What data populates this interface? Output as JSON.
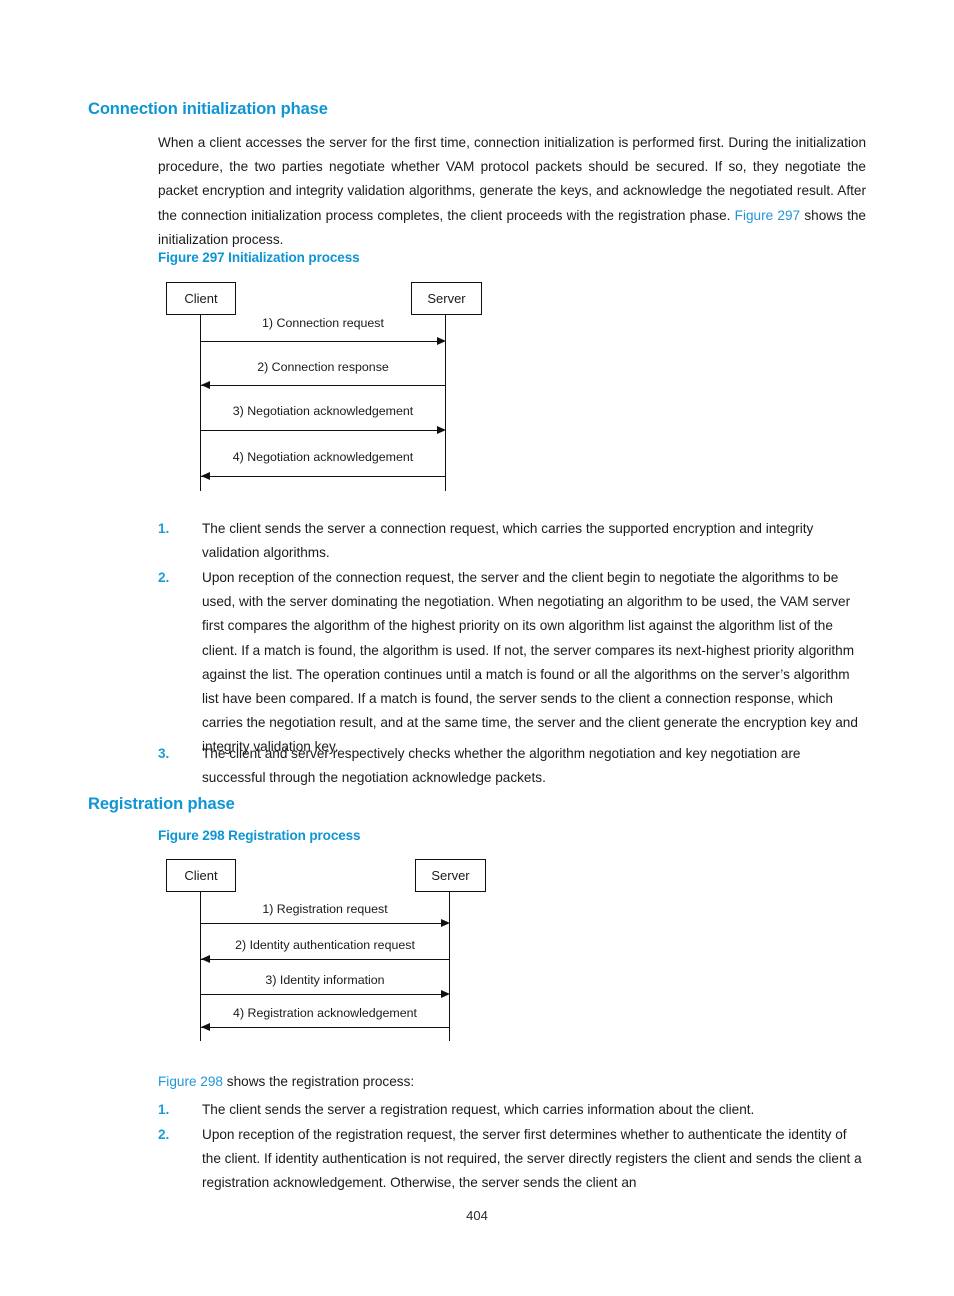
{
  "page": {
    "number": "404"
  },
  "sections": [
    {
      "heading": "Connection initialization phase",
      "intro_a": "When a client accesses the server for the first time, connection initialization is performed first. During the initialization procedure, the two parties negotiate whether VAM protocol packets should be secured. If so, they negotiate the packet encryption and integrity validation algorithms, generate the keys, and acknowledge the negotiated result. After the connection initialization process completes, the client proceeds with the registration phase. ",
      "intro_link": "Figure 297",
      "intro_b": " shows the initialization process.",
      "figure_caption": "Figure 297 Initialization process",
      "steps": [
        {
          "num": "1.",
          "text": "The client sends the server a connection request, which carries the supported encryption and integrity validation algorithms."
        },
        {
          "num": "2.",
          "text": "Upon reception of the connection request, the server and the client begin to negotiate the algorithms to be used, with the server dominating the negotiation. When negotiating an algorithm to be used, the VAM server first compares the algorithm of the highest priority on its own algorithm list against the algorithm list of the client. If a match is found, the algorithm is used. If not, the server compares its next-highest priority algorithm against the list. The operation continues until a match is found or all the algorithms on the server’s algorithm list have been compared. If a match is found, the server sends to the client a connection response, which carries the negotiation result, and at the same time, the server and the client generate the encryption key and integrity validation key."
        },
        {
          "num": "3.",
          "text": "The client and server respectively checks whether the algorithm negotiation and key negotiation are successful through the negotiation acknowledge packets."
        }
      ]
    },
    {
      "heading": "Registration phase",
      "figure_caption": "Figure 298 Registration process",
      "lead_link": "Figure 298",
      "lead_text": " shows the registration process:",
      "steps": [
        {
          "num": "1.",
          "text": "The client sends the server a registration request, which carries information about the client."
        },
        {
          "num": "2.",
          "text": "Upon reception of the registration request, the server first determines whether to authenticate the identity of the client. If identity authentication is not required, the server directly registers the client and sends the client a registration acknowledgement. Otherwise, the server sends the client an"
        }
      ]
    }
  ],
  "diagram1": {
    "actors": {
      "left": "Client",
      "right": "Server"
    },
    "messages": [
      {
        "label": "1) Connection request",
        "direction": "right"
      },
      {
        "label": "2) Connection response",
        "direction": "left"
      },
      {
        "label": "3) Negotiation acknowledgement",
        "direction": "right"
      },
      {
        "label": "4) Negotiation acknowledgement",
        "direction": "left"
      }
    ]
  },
  "diagram2": {
    "actors": {
      "left": "Client",
      "right": "Server"
    },
    "messages": [
      {
        "label": "1) Registration request",
        "direction": "right"
      },
      {
        "label": "2) Identity authentication request",
        "direction": "left"
      },
      {
        "label": "3) Identity information",
        "direction": "right"
      },
      {
        "label": "4) Registration acknowledgement",
        "direction": "left"
      }
    ]
  },
  "colors": {
    "heading_blue": "#0e95d3",
    "link_blue": "#2196d8",
    "list_number_blue": "#1e9cd7",
    "ink": "#1a1a1a"
  }
}
